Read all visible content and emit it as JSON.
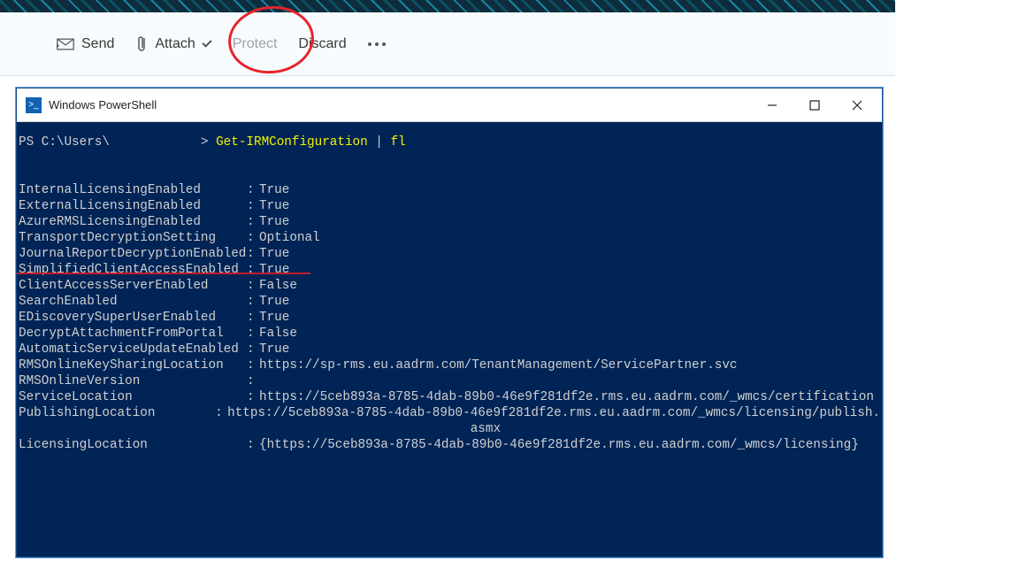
{
  "compose": {
    "send": "Send",
    "attach": "Attach",
    "protect": "Protect",
    "discard": "Discard"
  },
  "pswindow": {
    "title": "Windows PowerShell",
    "prompt_prefix": "PS C:\\Users\\",
    "prompt_sep": " > ",
    "command": "Get-IRMConfiguration",
    "pipe": " | ",
    "command2": "fl"
  },
  "irm": [
    {
      "key": "InternalLicensingEnabled",
      "value": "True"
    },
    {
      "key": "ExternalLicensingEnabled",
      "value": "True"
    },
    {
      "key": "AzureRMSLicensingEnabled",
      "value": "True"
    },
    {
      "key": "TransportDecryptionSetting",
      "value": "Optional"
    },
    {
      "key": "JournalReportDecryptionEnabled",
      "value": "True"
    },
    {
      "key": "SimplifiedClientAccessEnabled",
      "value": "True"
    },
    {
      "key": "ClientAccessServerEnabled",
      "value": "False"
    },
    {
      "key": "SearchEnabled",
      "value": "True"
    },
    {
      "key": "EDiscoverySuperUserEnabled",
      "value": "True"
    },
    {
      "key": "DecryptAttachmentFromPortal",
      "value": "False"
    },
    {
      "key": "AutomaticServiceUpdateEnabled",
      "value": "True"
    },
    {
      "key": "RMSOnlineKeySharingLocation",
      "value": "https://sp-rms.eu.aadrm.com/TenantManagement/ServicePartner.svc"
    },
    {
      "key": "RMSOnlineVersion",
      "value": ""
    },
    {
      "key": "ServiceLocation",
      "value": "https://5ceb893a-8785-4dab-89b0-46e9f281df2e.rms.eu.aadrm.com/_wmcs/certification"
    },
    {
      "key": "PublishingLocation",
      "value": "https://5ceb893a-8785-4dab-89b0-46e9f281df2e.rms.eu.aadrm.com/_wmcs/licensing/publish.\n                                asmx"
    },
    {
      "key": "LicensingLocation",
      "value": "{https://5ceb893a-8785-4dab-89b0-46e9f281df2e.rms.eu.aadrm.com/_wmcs/licensing}"
    }
  ]
}
